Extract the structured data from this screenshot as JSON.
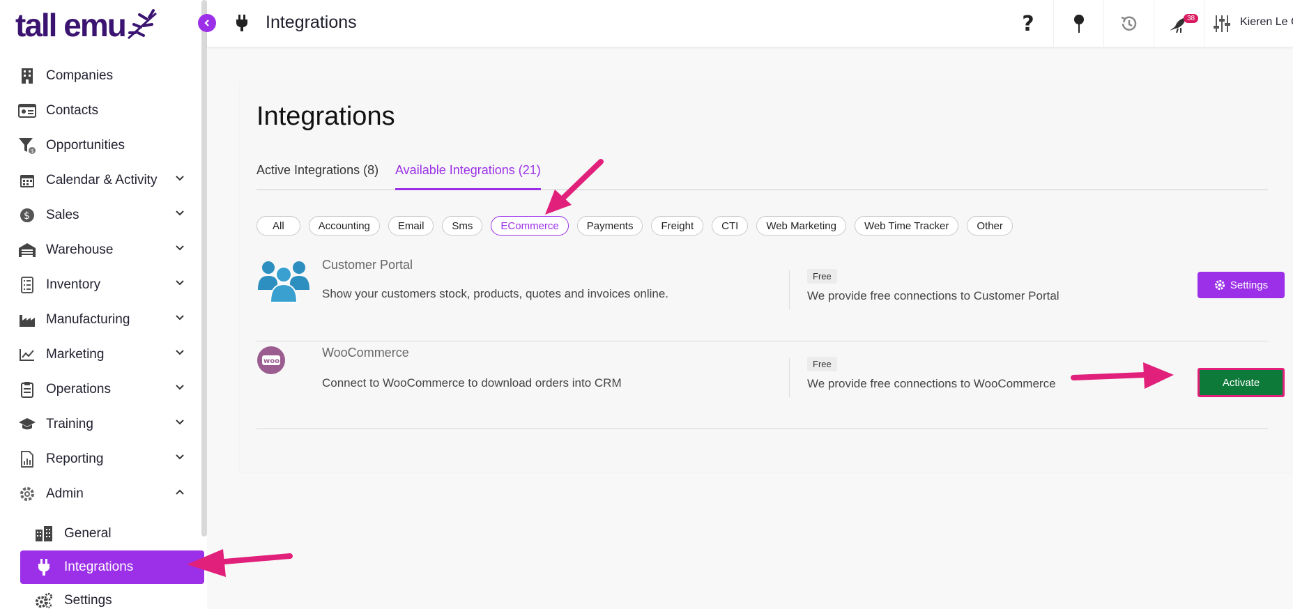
{
  "brand": {
    "logo_text": "tall emu"
  },
  "sidebar": {
    "items": [
      {
        "label": "Companies",
        "icon": "building-icon",
        "expandable": false
      },
      {
        "label": "Contacts",
        "icon": "contact-card-icon",
        "expandable": false
      },
      {
        "label": "Opportunities",
        "icon": "funnel-icon",
        "expandable": false
      },
      {
        "label": "Calendar & Activity",
        "icon": "calendar-icon",
        "expandable": true
      },
      {
        "label": "Sales",
        "icon": "dollar-icon",
        "expandable": true
      },
      {
        "label": "Warehouse",
        "icon": "warehouse-icon",
        "expandable": true
      },
      {
        "label": "Inventory",
        "icon": "list-icon",
        "expandable": true
      },
      {
        "label": "Manufacturing",
        "icon": "factory-icon",
        "expandable": true
      },
      {
        "label": "Marketing",
        "icon": "chart-line-icon",
        "expandable": true
      },
      {
        "label": "Operations",
        "icon": "clipboard-icon",
        "expandable": true
      },
      {
        "label": "Training",
        "icon": "graduation-cap-icon",
        "expandable": true
      },
      {
        "label": "Reporting",
        "icon": "report-icon",
        "expandable": true
      },
      {
        "label": "Admin",
        "icon": "gear-icon",
        "expandable": true,
        "expanded": true
      }
    ],
    "admin_sub": [
      {
        "label": "General",
        "icon": "city-icon"
      },
      {
        "label": "Integrations",
        "icon": "plug-icon",
        "active": true
      },
      {
        "label": "Settings",
        "icon": "gears-icon"
      }
    ]
  },
  "header": {
    "title": "Integrations",
    "notification_count": "38",
    "user_name": "Kieren Le G"
  },
  "main": {
    "title": "Integrations",
    "tabs": [
      {
        "label": "Active Integrations (8)",
        "active": false
      },
      {
        "label": "Available Integrations (21)",
        "active": true
      }
    ],
    "filters": [
      {
        "label": "All"
      },
      {
        "label": "Accounting"
      },
      {
        "label": "Email"
      },
      {
        "label": "Sms"
      },
      {
        "label": "ECommerce",
        "active": true
      },
      {
        "label": "Payments"
      },
      {
        "label": "Freight"
      },
      {
        "label": "CTI"
      },
      {
        "label": "Web Marketing"
      },
      {
        "label": "Web Time Tracker"
      },
      {
        "label": "Other"
      }
    ],
    "integrations": [
      {
        "name": "Customer Portal",
        "description": "Show your customers stock, products, quotes and invoices online.",
        "tag": "Free",
        "pricing_text": "We provide free connections to Customer Portal",
        "button_label": "Settings"
      },
      {
        "name": "WooCommerce",
        "description": "Connect to WooCommerce to download orders into CRM",
        "tag": "Free",
        "pricing_text": "We provide free connections to WooCommerce",
        "button_label": "Activate",
        "icon_text": "woo"
      }
    ]
  },
  "colors": {
    "accent": "#9b30e8",
    "brand": "#3a1470",
    "activate": "#0e7a3a",
    "annotation": "#e0207a"
  }
}
